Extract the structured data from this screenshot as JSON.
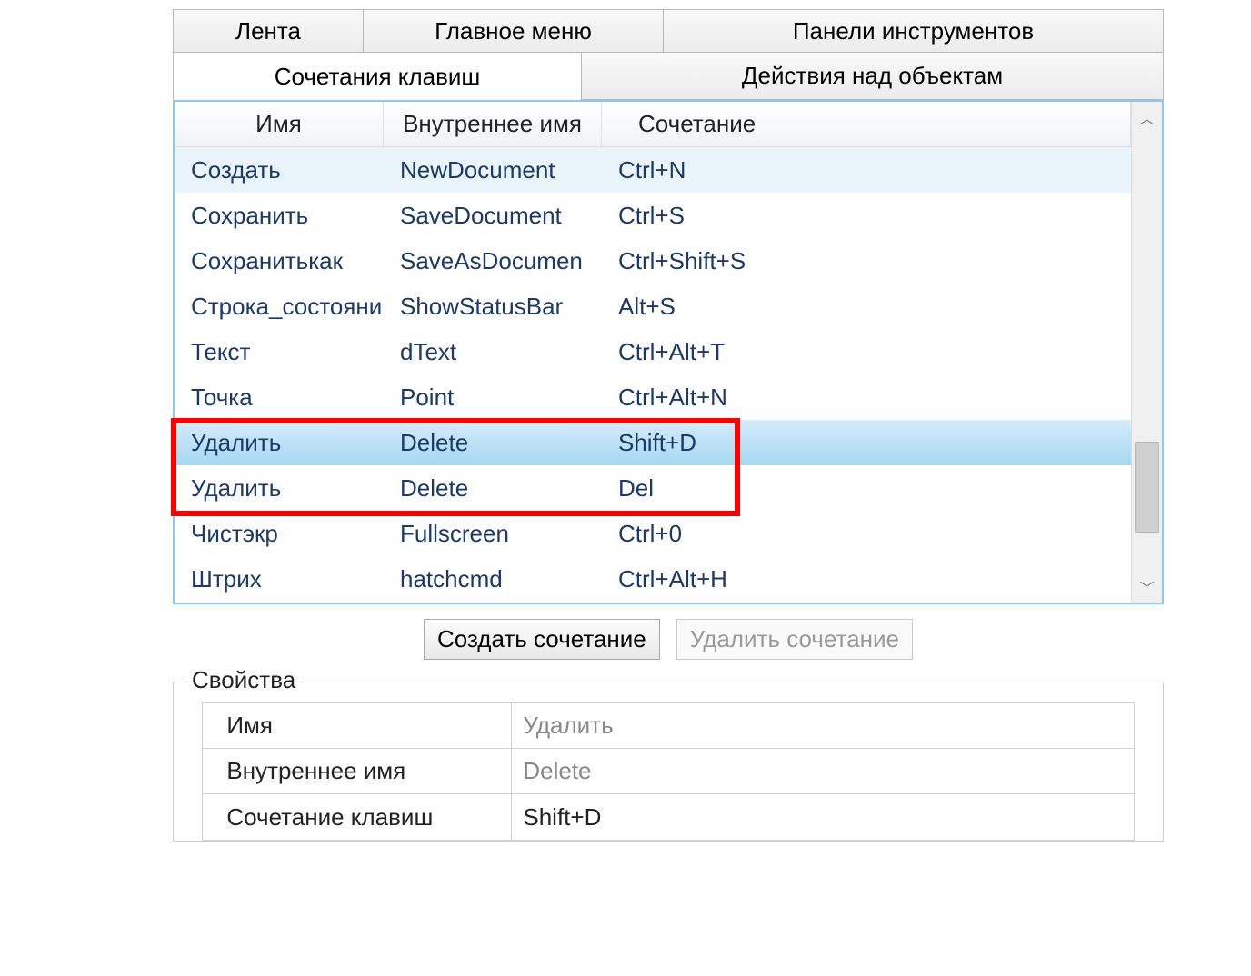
{
  "tabs_row1": {
    "lenta": "Лента",
    "main_menu": "Главное меню",
    "toolbars": "Панели инструментов"
  },
  "tabs_row2": {
    "shortcuts": "Сочетания клавиш",
    "object_actions": "Действия над объектам"
  },
  "table": {
    "headers": {
      "name": "Имя",
      "internal": "Внутреннее имя",
      "shortcut": "Сочетание"
    },
    "rows": [
      {
        "name": "Создать",
        "internal": "NewDocument",
        "shortcut": "Ctrl+N",
        "state": "hover"
      },
      {
        "name": "Сохранить",
        "internal": "SaveDocument",
        "shortcut": "Ctrl+S",
        "state": ""
      },
      {
        "name": "Сохранитькак",
        "internal": "SaveAsDocumen",
        "shortcut": "Ctrl+Shift+S",
        "state": ""
      },
      {
        "name": "Строка_состояни",
        "internal": "ShowStatusBar",
        "shortcut": "Alt+S",
        "state": ""
      },
      {
        "name": "Текст",
        "internal": "dText",
        "shortcut": "Ctrl+Alt+T",
        "state": ""
      },
      {
        "name": "Точка",
        "internal": "Point",
        "shortcut": "Ctrl+Alt+N",
        "state": ""
      },
      {
        "name": "Удалить",
        "internal": "Delete",
        "shortcut": "Shift+D",
        "state": "selected"
      },
      {
        "name": "Удалить",
        "internal": "Delete",
        "shortcut": "Del",
        "state": ""
      },
      {
        "name": "Чистэкр",
        "internal": "Fullscreen",
        "shortcut": "Ctrl+0",
        "state": ""
      },
      {
        "name": "Штрих",
        "internal": "hatchcmd",
        "shortcut": "Ctrl+Alt+H",
        "state": ""
      }
    ]
  },
  "buttons": {
    "create": "Создать сочетание",
    "delete": "Удалить сочетание"
  },
  "properties": {
    "group_title": "Свойства",
    "rows": {
      "name_label": "Имя",
      "name_value": "Удалить",
      "internal_label": "Внутреннее имя",
      "internal_value": "Delete",
      "shortcut_label": "Сочетание клавиш",
      "shortcut_value": "Shift+D"
    }
  },
  "scroll": {
    "up": "︿",
    "down": "﹀"
  }
}
